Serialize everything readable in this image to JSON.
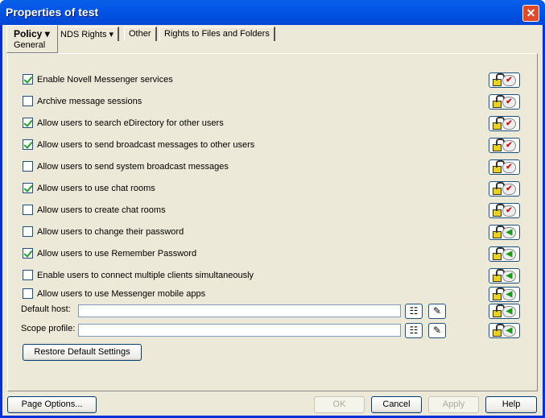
{
  "window": {
    "title": "Properties of test"
  },
  "tabs": [
    {
      "label": "Policy",
      "sub": "General"
    },
    {
      "label": "NDS Rights"
    },
    {
      "label": "Other"
    },
    {
      "label": "Rights to Files and Folders"
    }
  ],
  "options": [
    {
      "label": "Enable Novell Messenger services",
      "checked": true,
      "icon": "lock-check"
    },
    {
      "label": "Archive message sessions",
      "checked": false,
      "icon": "lock-check"
    },
    {
      "label": "Allow users to search eDirectory for other users",
      "checked": true,
      "icon": "lock-check"
    },
    {
      "label": "Allow users to send broadcast messages to other users",
      "checked": true,
      "icon": "lock-check"
    },
    {
      "label": "Allow users to send system broadcast messages",
      "checked": false,
      "icon": "lock-check"
    },
    {
      "label": "Allow users to use chat rooms",
      "checked": true,
      "icon": "lock-check"
    },
    {
      "label": "Allow users to create chat rooms",
      "checked": false,
      "icon": "lock-check"
    },
    {
      "label": "Allow users to change their password",
      "checked": false,
      "icon": "lock-arrow"
    },
    {
      "label": "Allow users to use Remember Password",
      "checked": true,
      "icon": "lock-arrow"
    },
    {
      "label": "Enable users to connect  multiple clients simultaneously",
      "checked": false,
      "icon": "lock-arrow"
    },
    {
      "label": "Allow users to use Messenger mobile apps",
      "checked": false,
      "icon": "lock-arrow"
    }
  ],
  "fields": [
    {
      "label": "Default host:",
      "value": ""
    },
    {
      "label": "Scope profile:",
      "value": ""
    }
  ],
  "restore_label": "Restore Default Settings",
  "buttons": {
    "page_options": "Page Options...",
    "ok": "OK",
    "cancel": "Cancel",
    "apply": "Apply",
    "help": "Help"
  }
}
